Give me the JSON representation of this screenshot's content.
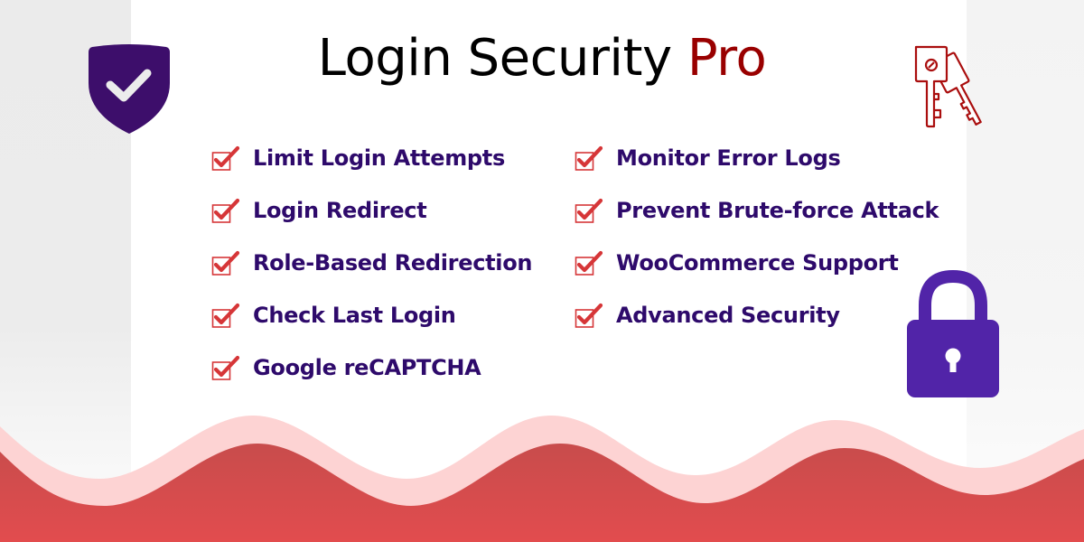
{
  "title": {
    "main": "Login Security ",
    "accent": "Pro"
  },
  "features_left": [
    "Limit Login Attempts",
    "Login Redirect",
    "Role-Based Redirection",
    "Check Last Login",
    "Google reCAPTCHA"
  ],
  "features_right": [
    "Monitor Error Logs",
    "Prevent Brute-force Attack",
    "WooCommerce Support",
    "Advanced Security"
  ],
  "icons": {
    "shield": "shield-check-icon",
    "keys": "keys-icon",
    "lock": "padlock-icon",
    "bullet": "checkbox-checked-icon"
  },
  "colors": {
    "title": "#000000",
    "accent": "#990000",
    "feature_text": "#2e0a6b",
    "check": "#d63638",
    "shield": "#3d0e6b",
    "lock": "#5124a8",
    "wave_light": "#fdd3d3",
    "wave_dark": "#d9474a"
  }
}
